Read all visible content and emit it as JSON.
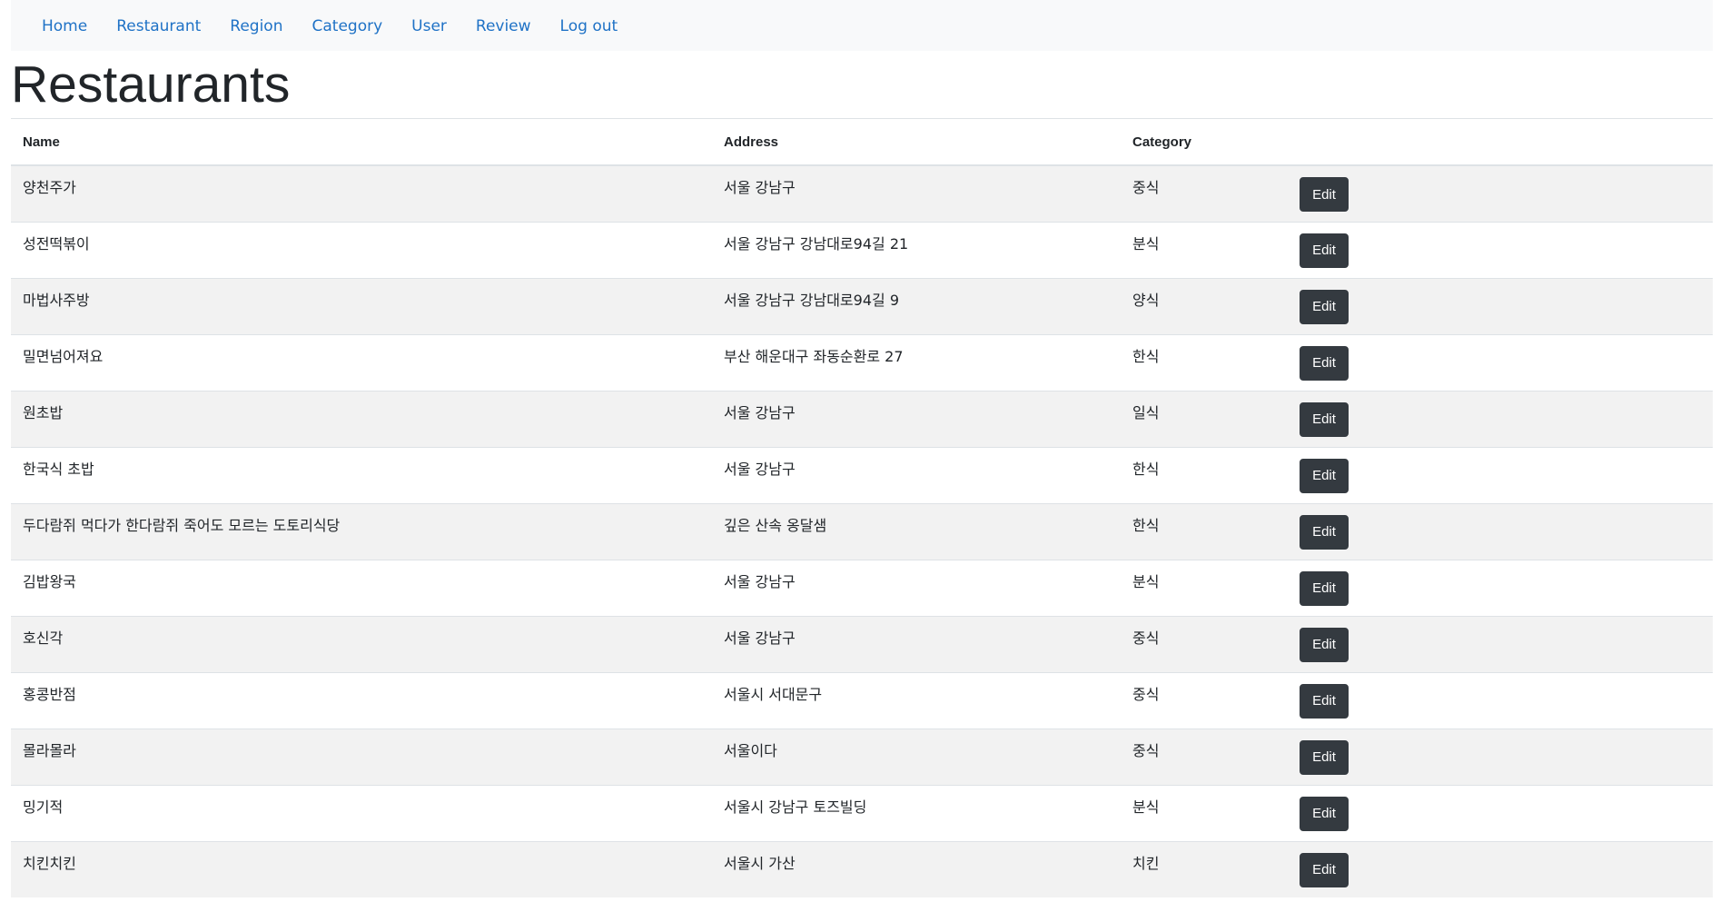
{
  "navbar": {
    "links": [
      "Home",
      "Restaurant",
      "Region",
      "Category",
      "User",
      "Review",
      "Log out"
    ]
  },
  "page": {
    "title": "Restaurants"
  },
  "table": {
    "headers": {
      "name": "Name",
      "address": "Address",
      "category": "Category"
    },
    "edit_label": "Edit",
    "rows": [
      {
        "name": "양천주가",
        "address": "서울 강남구",
        "category": "중식"
      },
      {
        "name": "성전떡볶이",
        "address": "서울 강남구 강남대로94길 21",
        "category": "분식"
      },
      {
        "name": "마법사주방",
        "address": "서울 강남구 강남대로94길 9",
        "category": "양식"
      },
      {
        "name": "밀면넘어져요",
        "address": "부산 해운대구 좌동순환로 27",
        "category": "한식"
      },
      {
        "name": "원초밥",
        "address": "서울 강남구",
        "category": "일식"
      },
      {
        "name": "한국식 초밥",
        "address": "서울 강남구",
        "category": "한식"
      },
      {
        "name": "두다람쥐 먹다가 한다람쥐 죽어도 모르는 도토리식당",
        "address": "깊은 산속 옹달샘",
        "category": "한식"
      },
      {
        "name": "김밥왕국",
        "address": "서울 강남구",
        "category": "분식"
      },
      {
        "name": "호신각",
        "address": "서울 강남구",
        "category": "중식"
      },
      {
        "name": "홍콩반점",
        "address": "서울시 서대문구",
        "category": "중식"
      },
      {
        "name": "몰라몰라",
        "address": "서울이다",
        "category": "중식"
      },
      {
        "name": "밍기적",
        "address": "서울시 강남구 토즈빌딩",
        "category": "분식"
      },
      {
        "name": "치킨치킨",
        "address": "서울시 가산",
        "category": "치킨"
      }
    ]
  }
}
